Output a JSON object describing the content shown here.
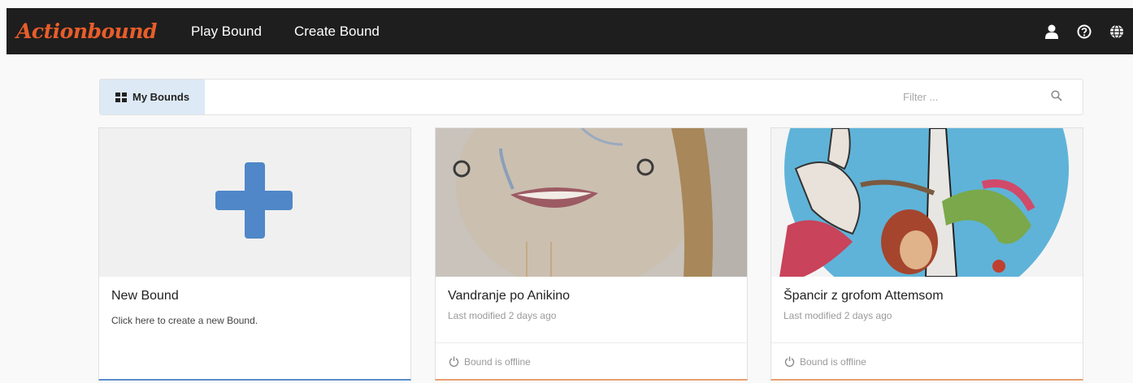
{
  "header": {
    "logo": "Actionbound",
    "nav": [
      {
        "label": "Play Bound"
      },
      {
        "label": "Create Bound"
      }
    ],
    "icons": [
      "user-icon",
      "help-icon",
      "globe-icon"
    ]
  },
  "toolbar": {
    "tab_label": "My Bounds",
    "filter_placeholder": "Filter ..."
  },
  "cards": [
    {
      "title": "New Bound",
      "subtitle": "Click here to create a new Bound.",
      "icon": "plus-icon"
    },
    {
      "title": "Vandranje po Anikino",
      "subtitle": "Last modified 2 days ago",
      "status": "Bound is offline"
    },
    {
      "title": "Špancir z grofom Attemsom",
      "subtitle": "Last modified 2 days ago",
      "status": "Bound is offline"
    }
  ],
  "colors": {
    "topbar": "#1e1e1e",
    "logo": "#e85d2a",
    "accent_blue": "#4f87c8",
    "offline_border": "#e8a070"
  }
}
